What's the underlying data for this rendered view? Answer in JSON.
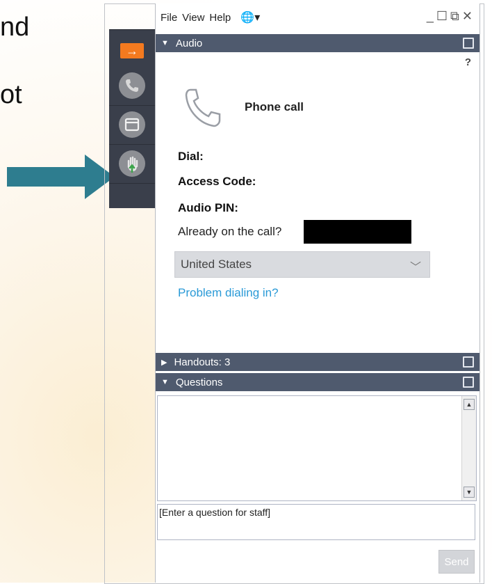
{
  "slide": {
    "line1": "nd",
    "line2": "ot"
  },
  "menu": {
    "file": "File",
    "view": "View",
    "help": "Help",
    "globe": "🌐▾",
    "window_controls": "_☐⧉✕"
  },
  "toolbar": {
    "collapse_arrow": "→",
    "icons": [
      "phone-icon",
      "window-icon",
      "raise-hand-icon"
    ]
  },
  "audio": {
    "title": "Audio",
    "help_mark": "?",
    "mode": "Phone call",
    "dial_label": "Dial:",
    "access_label": "Access Code:",
    "pin_label": "Audio PIN:",
    "already_label": "Already on the call?",
    "country": "United States",
    "problem_link": "Problem dialing in?"
  },
  "handouts": {
    "title": "Handouts: 3"
  },
  "questions": {
    "title": "Questions",
    "input_text": "[Enter a question for staff]",
    "send_label": "Send"
  },
  "colors": {
    "header": "#4f5a6e",
    "toolbar": "#3a3f4b",
    "accent_orange": "#f47a1f",
    "link": "#2a9ad7",
    "pointer_arrow": "#2e7d8f"
  }
}
